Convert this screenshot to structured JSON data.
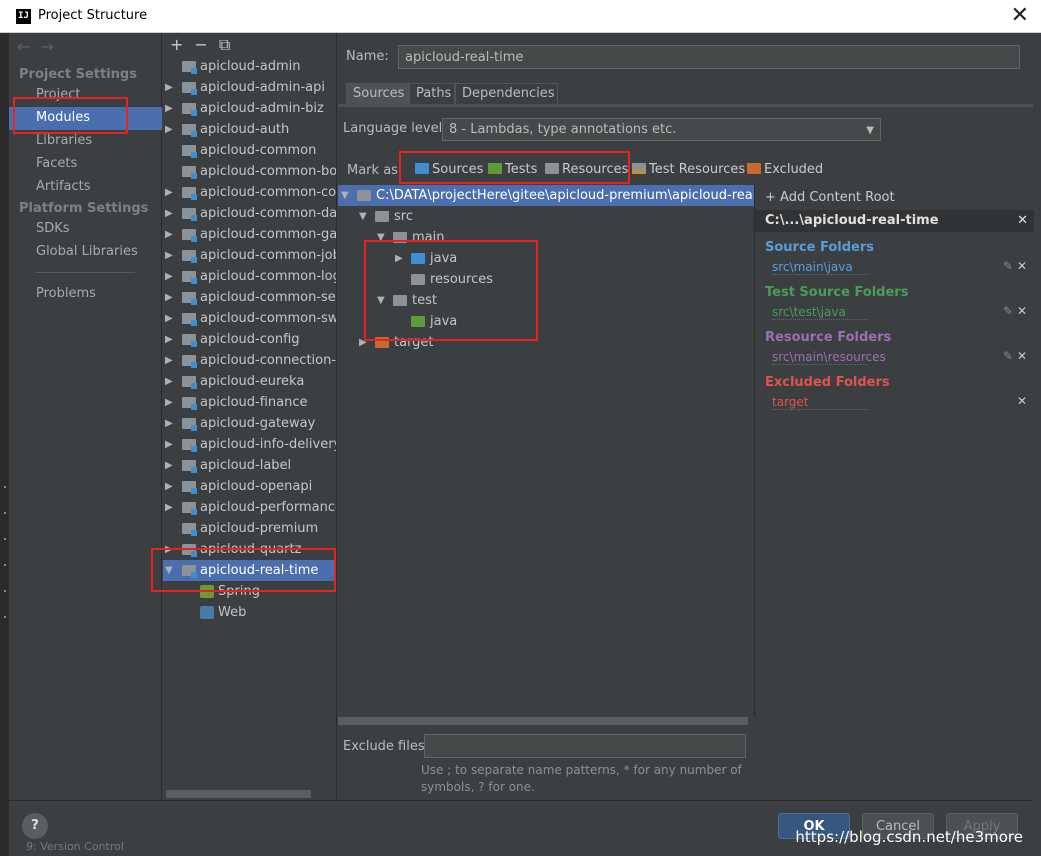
{
  "window": {
    "title": "Project Structure",
    "app_icon": "IJ",
    "close_icon": "✕"
  },
  "nav": {
    "back": "←",
    "forward": "→"
  },
  "settings": {
    "project_settings_header": "Project Settings",
    "project_items": [
      "Project",
      "Modules",
      "Libraries",
      "Facets",
      "Artifacts"
    ],
    "platform_settings_header": "Platform Settings",
    "platform_items": [
      "SDKs",
      "Global Libraries"
    ],
    "problems": "Problems",
    "selected": "Modules"
  },
  "modules_toolbar": {
    "add": "+",
    "remove": "−",
    "copy": "⧉"
  },
  "modules": [
    {
      "name": "apicloud-admin",
      "arrow": ""
    },
    {
      "name": "apicloud-admin-api",
      "arrow": "▶"
    },
    {
      "name": "apicloud-admin-biz",
      "arrow": "▶"
    },
    {
      "name": "apicloud-auth",
      "arrow": "▶"
    },
    {
      "name": "apicloud-common",
      "arrow": ""
    },
    {
      "name": "apicloud-common-bom",
      "arrow": ""
    },
    {
      "name": "apicloud-common-core",
      "arrow": "▶"
    },
    {
      "name": "apicloud-common-data",
      "arrow": "▶"
    },
    {
      "name": "apicloud-common-gate",
      "arrow": "▶"
    },
    {
      "name": "apicloud-common-job",
      "arrow": "▶"
    },
    {
      "name": "apicloud-common-log",
      "arrow": "▶"
    },
    {
      "name": "apicloud-common-secu",
      "arrow": "▶"
    },
    {
      "name": "apicloud-common-swag",
      "arrow": "▶"
    },
    {
      "name": "apicloud-config",
      "arrow": "▶"
    },
    {
      "name": "apicloud-connection-re",
      "arrow": "▶"
    },
    {
      "name": "apicloud-eureka",
      "arrow": "▶"
    },
    {
      "name": "apicloud-finance",
      "arrow": "▶"
    },
    {
      "name": "apicloud-gateway",
      "arrow": "▶"
    },
    {
      "name": "apicloud-info-delivery",
      "arrow": "▶"
    },
    {
      "name": "apicloud-label",
      "arrow": "▶"
    },
    {
      "name": "apicloud-openapi",
      "arrow": "▶"
    },
    {
      "name": "apicloud-performance",
      "arrow": "▶"
    },
    {
      "name": "apicloud-premium",
      "arrow": ""
    },
    {
      "name": "apicloud-quartz",
      "arrow": "▶"
    },
    {
      "name": "apicloud-real-time",
      "arrow": "▼"
    }
  ],
  "facets": [
    {
      "name": "Spring",
      "color": "#6a9a3a"
    },
    {
      "name": "Web",
      "color": "#4a7aa6"
    }
  ],
  "main": {
    "name_label": "Name:",
    "name_value": "apicloud-real-time",
    "tabs": [
      "Sources",
      "Paths",
      "Dependencies"
    ],
    "active_tab": "Sources",
    "language_level_label": "Language level:",
    "language_level_value": "8 - Lambdas, type annotations etc.",
    "mark_as_label": "Mark as:",
    "mark_as": [
      {
        "label": "Sources",
        "color": "#3d8fd1"
      },
      {
        "label": "Tests",
        "color": "#5c9a3a"
      },
      {
        "label": "Resources",
        "color": "#8d9297"
      },
      {
        "label": "Test Resources",
        "color": "#8d9297"
      },
      {
        "label": "Excluded",
        "color": "#c86a30"
      }
    ],
    "tree": [
      {
        "label": "C:\\DATA\\projectHere\\gitee\\apicloud-premium\\apicloud-real-time",
        "arrow": "▼",
        "color": "#8d9297",
        "level": 0
      },
      {
        "label": "src",
        "arrow": "▼",
        "color": "#8d9297",
        "level": 1
      },
      {
        "label": "main",
        "arrow": "▼",
        "color": "#8d9297",
        "level": 2
      },
      {
        "label": "java",
        "arrow": "▶",
        "color": "#3d8fd1",
        "level": 3
      },
      {
        "label": "resources",
        "arrow": "",
        "color": "#8d9297",
        "level": 3
      },
      {
        "label": "test",
        "arrow": "▼",
        "color": "#8d9297",
        "level": 2
      },
      {
        "label": "java",
        "arrow": "",
        "color": "#5c9a3a",
        "level": 3
      },
      {
        "label": "target",
        "arrow": "▶",
        "color": "#c86a30",
        "level": 1
      }
    ],
    "exclude_files_label": "Exclude files:",
    "exclude_files_value": "",
    "exclude_hint": "Use ; to separate name patterns, * for any number of symbols, ? for one."
  },
  "roots": {
    "add_content_root": "+ Add Content Root",
    "root_path": "C:\\...\\apicloud-real-time",
    "categories": [
      {
        "title": "Source Folders",
        "color": "#5b9ddb",
        "path": "src\\main\\java"
      },
      {
        "title": "Test Source Folders",
        "color": "#4b9d56",
        "path": "src\\test\\java"
      },
      {
        "title": "Resource Folders",
        "color": "#9b6fb1",
        "path": "src\\main\\resources"
      },
      {
        "title": "Excluded Folders",
        "color": "#e0524b",
        "path": "target"
      }
    ],
    "close_icon": "✕",
    "edit_icon": "✎"
  },
  "buttons": {
    "help": "?",
    "ok": "OK",
    "cancel": "Cancel",
    "apply": "Apply"
  },
  "watermark": "https://blog.csdn.net/he3more",
  "version_control_label": "9: Version Control"
}
